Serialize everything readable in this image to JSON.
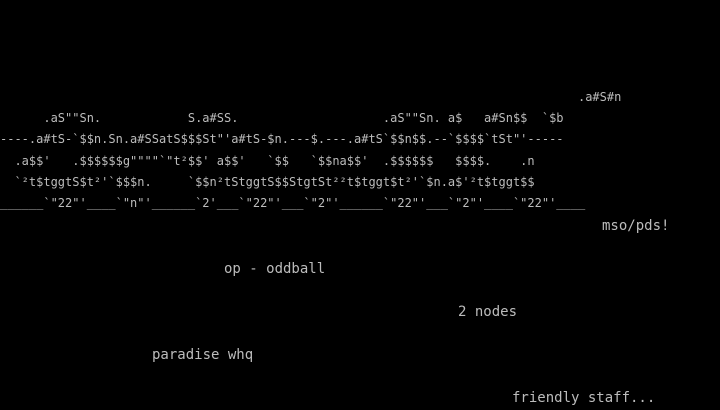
{
  "screen": {
    "text_color": "#bcbcbc",
    "background_color": "#000000"
  },
  "logo_lines": [
    "                                                                                .a#S#n",
    "      .aS\"\"Sn.            S.a#SS.                    .aS\"\"Sn. a$   a#Sn$$  `$b",
    "----.a#tS-`$$n.Sn.a#SSatS$$$St\"'a#tS-$n.---$.---.a#tS`$$n$$.--`$$$$`tSt\"'-----",
    "  .a$$'   .$$$$$$g\"\"\"\"`\"t²$$' a$$'   `$$   `$$na$$'  .$$$$$$   $$$$.    .n",
    "  `²t$tggtS$t²'`$$$n.     `$$n²tStggtS$$StgtSt²²t$tggt$t²'`$n.a$'²t$tggt$$",
    "______`\"22\"'____`\"n\"'______`2'___`\"22\"'___`\"2\"'______`\"22\"'___`\"2\"'____`\"22\"'____"
  ],
  "credit": "mso/pds!",
  "lines": {
    "op": "op - oddball",
    "nodes": "2 nodes",
    "whq": "paradise whq",
    "staff": "friendly staff..."
  }
}
